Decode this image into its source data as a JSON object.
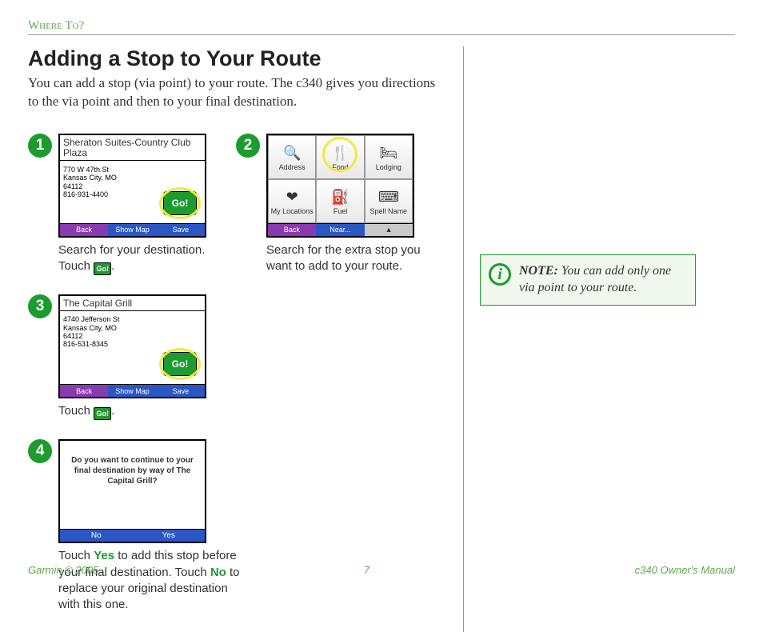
{
  "header": {
    "breadcrumb": "Where To?"
  },
  "title": "Adding a Stop to Your Route",
  "intro": "You can add a stop (via point) to your route. The c340 gives you directions to the via point and then to your final destination.",
  "steps": {
    "s1": {
      "num": "1",
      "screen_title": "Sheraton Suites-Country Club Plaza",
      "addr_line1": "770 W 47th St",
      "addr_line2": "Kansas City, MO",
      "addr_line3": "64112",
      "addr_line4": "816-931-4400",
      "go": "Go!",
      "sk_back": "Back",
      "sk_mid": "Show Map",
      "sk_save": "Save",
      "caption_a": "Search for your destination. Touch ",
      "caption_b": "."
    },
    "s2": {
      "num": "2",
      "cats": [
        "Address",
        "Food",
        "Lodging",
        "My Locations",
        "Fuel",
        "Spell Name"
      ],
      "sk_back": "Back",
      "sk_near": "Near...",
      "caption": "Search for the extra stop you want to add to your route."
    },
    "s3": {
      "num": "3",
      "screen_title": "The Capital Grill",
      "addr_line1": "4740 Jefferson St",
      "addr_line2": "Kansas City, MO",
      "addr_line3": "64112",
      "addr_line4": "816-531-8345",
      "go": "Go!",
      "sk_back": "Back",
      "sk_mid": "Show Map",
      "sk_save": "Save",
      "caption_a": "Touch ",
      "caption_b": "."
    },
    "s4": {
      "num": "4",
      "prompt": "Do you want to continue to your final destination by way of The Capital Grill?",
      "btn_no": "No",
      "btn_yes": "Yes",
      "caption_a": "Touch ",
      "yes": "Yes",
      "caption_b": " to add this stop before your final destination. Touch ",
      "no": "No",
      "caption_c": " to replace your original destination with this one."
    }
  },
  "note": {
    "label": "NOTE:",
    "text": " You can add only one via point to your route."
  },
  "footer": {
    "left": "Garmin © 2005",
    "center": "7",
    "right": "c340 Owner's Manual"
  },
  "inline_go": "Go!"
}
